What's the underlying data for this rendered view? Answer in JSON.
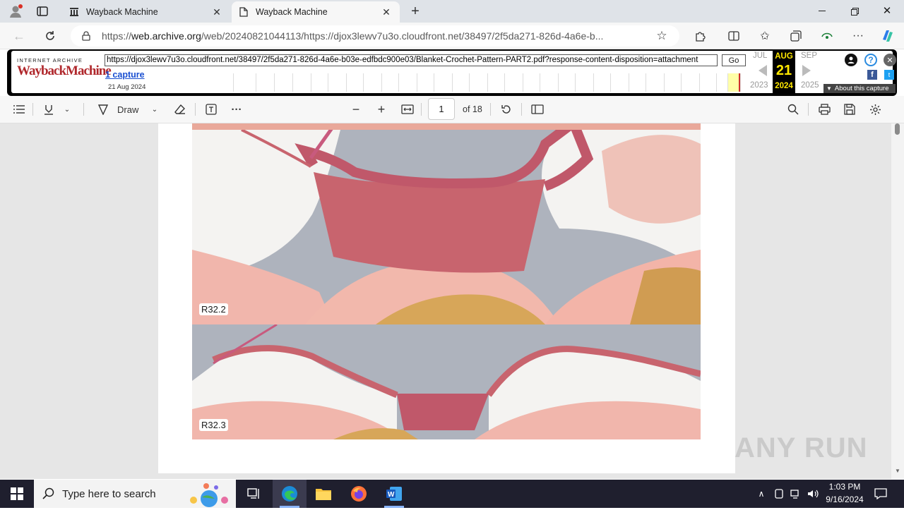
{
  "browser": {
    "tabs": [
      {
        "title": "Wayback Machine",
        "active": false
      },
      {
        "title": "Wayback Machine",
        "active": true
      }
    ],
    "address": {
      "prefix": "https://",
      "host": "web.archive.org",
      "path": "/web/20240821044113/https://djox3lewv7u3o.cloudfront.net/38497/2f5da271-826d-4a6e-b..."
    }
  },
  "wayback": {
    "logo_top": "INTERNET ARCHIVE",
    "logo_main": "WaybackMachine",
    "url_value": "https://djox3lewv7u3o.cloudfront.net/38497/2f5da271-826d-4a6e-b03e-edfbdc900e03/Blanket-Crochet-Pattern-PART2.pdf?response-content-disposition=attachment",
    "go_label": "Go",
    "captures": "1 capture",
    "capture_date": "21 Aug 2024",
    "prev_month": "JUL",
    "cur_month": "AUG",
    "next_month": "SEP",
    "day": "21",
    "prev_year": "2023",
    "cur_year": "2024",
    "next_year": "2025",
    "about": "About this capture"
  },
  "pdf": {
    "draw_label": "Draw",
    "page_value": "1",
    "page_total": "of 18",
    "captions": [
      "R32.2",
      "R32.3"
    ]
  },
  "taskbar": {
    "search_placeholder": "Type here to search",
    "time": "1:03 PM",
    "date": "9/16/2024"
  },
  "watermark": "ANY RUN",
  "colors": {
    "yarn_rose": "#c8646e",
    "yarn_pink": "#f1b6ac",
    "yarn_white": "#f4f3f1",
    "wayback_red": "#b0282c",
    "calendar_yellow": "#ffe800"
  }
}
